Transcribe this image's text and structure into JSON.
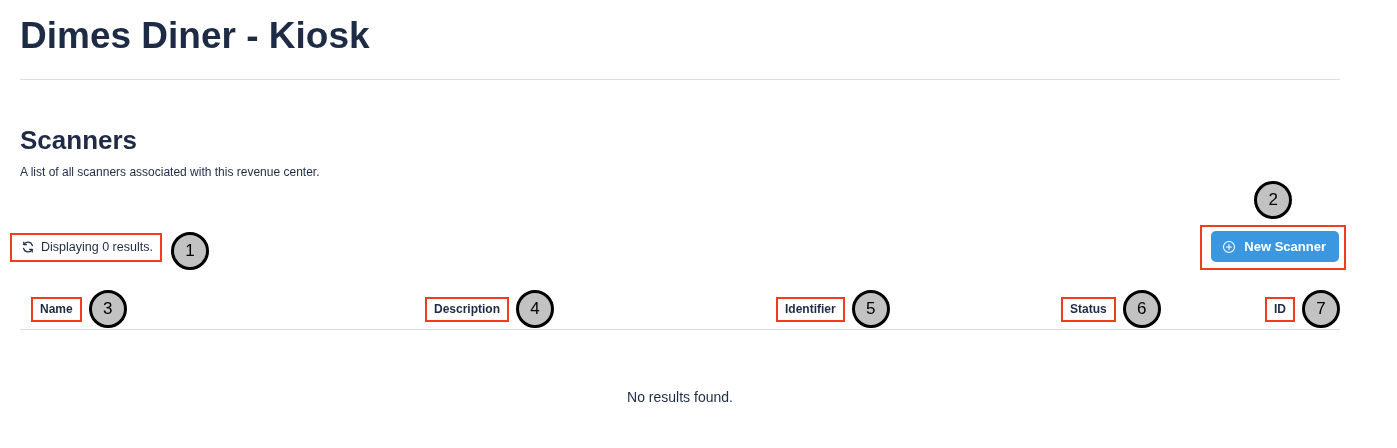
{
  "page": {
    "title": "Dimes Diner - Kiosk"
  },
  "section": {
    "title": "Scanners",
    "description": "A list of all scanners associated with this revenue center."
  },
  "toolbar": {
    "status": {
      "text": "Displaying 0 results.",
      "callout": "1"
    },
    "new_button": {
      "label": "New Scanner",
      "callout": "2"
    }
  },
  "table": {
    "columns": [
      {
        "label": "Name",
        "callout": "3"
      },
      {
        "label": "Description",
        "callout": "4"
      },
      {
        "label": "Identifier",
        "callout": "5"
      },
      {
        "label": "Status",
        "callout": "6"
      },
      {
        "label": "ID",
        "callout": "7"
      }
    ],
    "empty_message": "No results found."
  }
}
